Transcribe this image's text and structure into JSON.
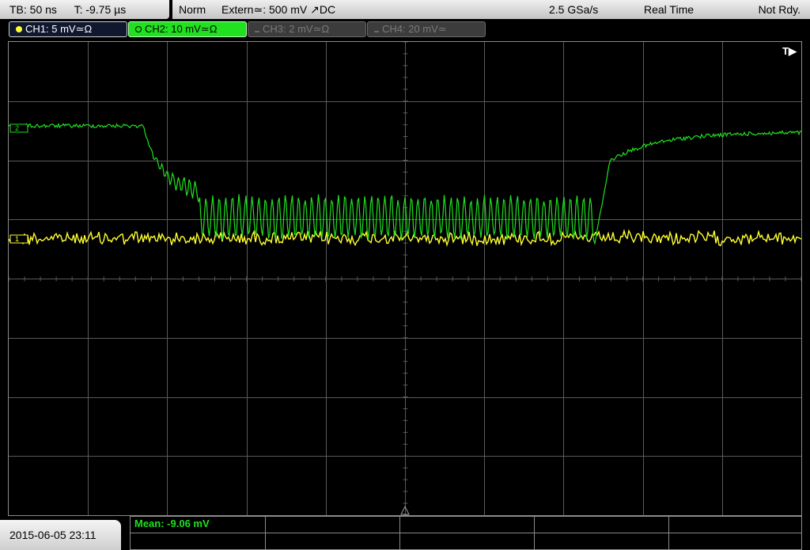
{
  "topbar": {
    "timebase": "TB: 50 ns",
    "trigger_time": "T: -9.75 µs",
    "mode": "Norm",
    "trigger_source": "Extern≃: 500 mV ↗DC",
    "sample_rate": "2.5 GSa/s",
    "acquisition": "Real Time",
    "state": "Not Rdy."
  },
  "channels": [
    {
      "label": "CH1: 5 mV≃Ω",
      "color": "#ffff30",
      "active": true
    },
    {
      "label": "CH2: 10 mV≃Ω",
      "color": "#20e020",
      "active": true,
      "selected": true
    },
    {
      "label": "CH3: 2 mV≃Ω",
      "color": "#6a6a6a",
      "active": false
    },
    {
      "label": "CH4: 20 mV≃",
      "color": "#6a6a6a",
      "active": false
    }
  ],
  "plot": {
    "trigger_marker": "T▶",
    "ch1_marker": "1",
    "ch2_marker": "2",
    "grid_divisions": {
      "x": 10,
      "y": 8
    }
  },
  "bottom": {
    "timestamp": "2015-06-05 23:11",
    "measurement": "Mean: -9.06 mV"
  },
  "colors": {
    "ch1": "#ffff30",
    "ch2": "#20e020",
    "grid": "#5a5a5a"
  }
}
